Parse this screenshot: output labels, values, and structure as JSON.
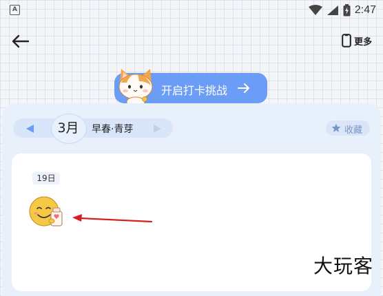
{
  "status_bar": {
    "notification_letter": "A",
    "time": "2:47"
  },
  "top_bar": {
    "more_label": "更多"
  },
  "challenge": {
    "label": "开启打卡挑战"
  },
  "calendar": {
    "month_label": "3月",
    "season_label": "早春·青芽",
    "favorite_label": "收藏"
  },
  "entry": {
    "day_label": "19日"
  },
  "watermark": "大玩客",
  "colors": {
    "accent_blue": "#6b9cf6",
    "card_bg": "#e8f0fc",
    "annotation_red": "#d42020"
  },
  "icons": {
    "back": "arrow-left-icon",
    "more": "phone-outline-icon",
    "prev": "triangle-left-icon",
    "next": "triangle-right-icon",
    "favorite": "star-icon",
    "challenge_arrow": "arrow-right-icon"
  }
}
